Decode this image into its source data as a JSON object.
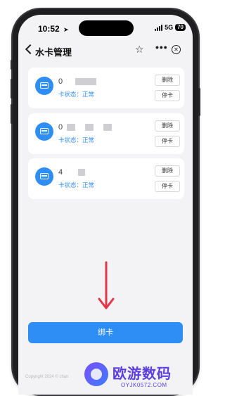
{
  "status_bar": {
    "time": "10:52",
    "location_glyph": "➤",
    "network": "5G",
    "battery": "70"
  },
  "navbar": {
    "title": "水卡管理",
    "back_icon": "chevron-left-icon",
    "star_glyph": "☆",
    "more_glyph": "•••",
    "close_glyph": "✕"
  },
  "cards": [
    {
      "number": "0",
      "status": "卡状态：正常",
      "delete_label": "删除",
      "stop_label": "停卡"
    },
    {
      "number": "0",
      "status": "卡状态：正常",
      "delete_label": "删除",
      "stop_label": "停卡"
    },
    {
      "number": "4",
      "status": "卡状态：正常",
      "delete_label": "删除",
      "stop_label": "停卡"
    }
  ],
  "bind_button": {
    "label": "绑卡"
  },
  "footer": {
    "copyright": "Copyright 2024 © chan"
  },
  "watermark": {
    "title": "欧游数码",
    "subtitle": "OYJK0572.COM"
  },
  "colors": {
    "accent": "#2f8ef5",
    "arrow": "#e2364b",
    "background": "#f3f3f5",
    "watermark": "#5b3fe0"
  }
}
